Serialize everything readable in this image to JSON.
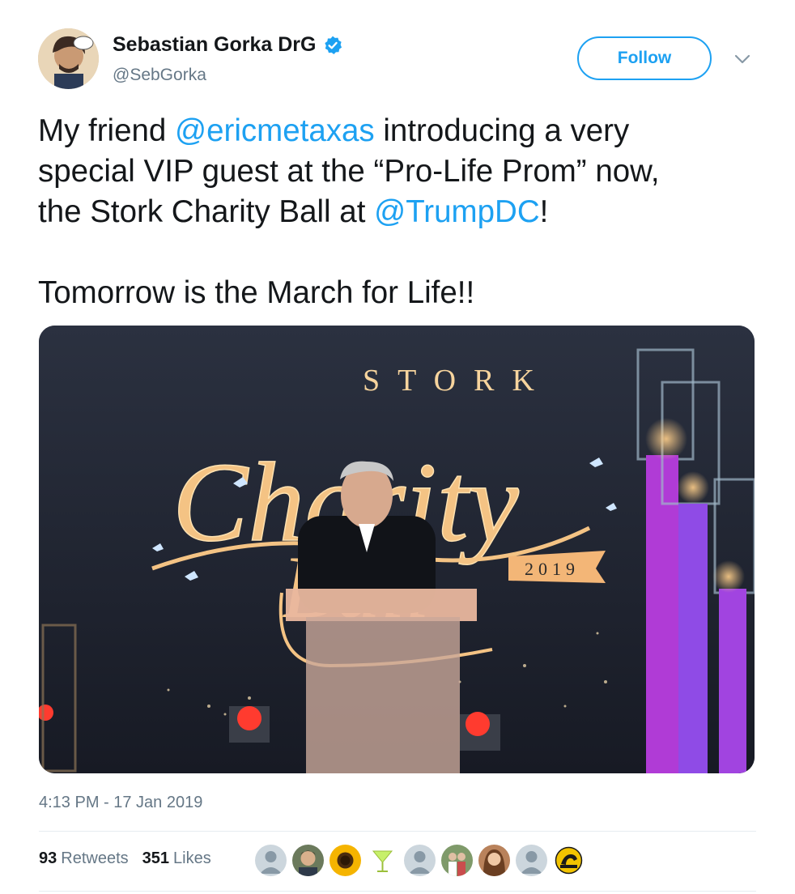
{
  "author": {
    "name": "Sebastian Gorka DrG",
    "handle": "@SebGorka",
    "verified": true
  },
  "follow_label": "Follow",
  "tweet": {
    "line1_pre": "My friend ",
    "line1_mention": "@ericmetaxas",
    "line1_post": " introducing a very",
    "line2": "special VIP guest at the “Pro-Life Prom” now,",
    "line3_pre": "the Stork Charity Ball at ",
    "line3_mention": "@TrumpDC",
    "line3_post": "!",
    "line4": "Tomorrow is the March for Life!!"
  },
  "photo": {
    "sign_top": "STORK",
    "sign_main": "Charity",
    "sign_ball": "Ball",
    "sign_year": "2019"
  },
  "timestamp": "4:13 PM - 17 Jan 2019",
  "stats": {
    "retweets_count": "93",
    "retweets_label": "Retweets",
    "likes_count": "351",
    "likes_label": "Likes"
  },
  "likers": [
    "default-avatar",
    "man-avatar",
    "sunflower-avatar",
    "cocktail-avatar",
    "default-avatar",
    "couple-avatar",
    "woman-avatar",
    "default-avatar",
    "libertarian-logo-avatar"
  ],
  "colors": {
    "link": "#1da1f2",
    "text": "#14171a",
    "muted": "#657786"
  }
}
